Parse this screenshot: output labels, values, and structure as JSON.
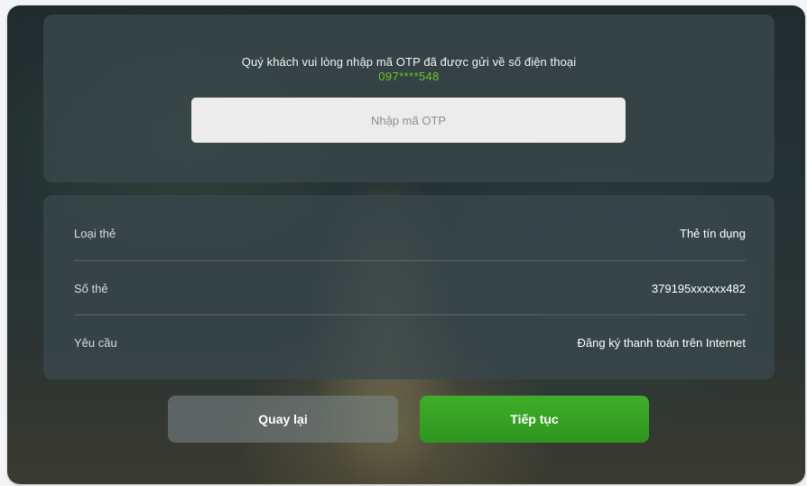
{
  "otp": {
    "message": "Quý khách vui lòng nhập mã OTP đã được gửi về số điện thoại",
    "phone": "097****548",
    "input_placeholder": "Nhập mã OTP",
    "input_value": ""
  },
  "details": {
    "rows": [
      {
        "label": "Loại thẻ",
        "value": "Thẻ tín dụng"
      },
      {
        "label": "Số thẻ",
        "value": "379195xxxxxx482"
      },
      {
        "label": "Yêu cầu",
        "value": "Đăng ký thanh toán trên Internet"
      }
    ]
  },
  "buttons": {
    "back_label": "Quay lại",
    "next_label": "Tiếp tục"
  },
  "colors": {
    "accent_green": "#3fae2a",
    "phone_green": "#6cc623"
  }
}
